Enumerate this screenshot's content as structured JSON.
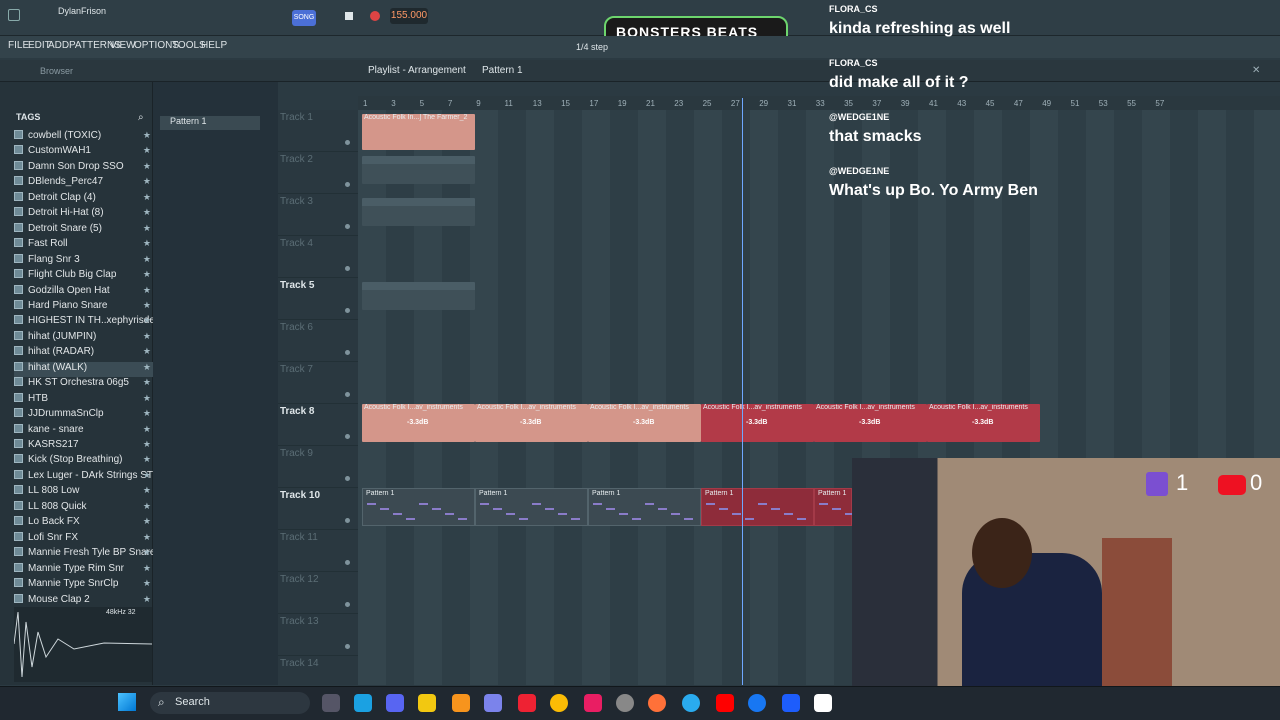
{
  "app": {
    "user": "DylanFrison",
    "tempo": "155.000",
    "snap": "1/4 step",
    "logo_text": "BONSTERS BEATS"
  },
  "menu": [
    "FILE",
    "EDIT",
    "ADD",
    "PATTERNS",
    "VIEW",
    "OPTIONS",
    "TOOLS",
    "HELP"
  ],
  "browser": {
    "title": "Browser",
    "tags_label": "TAGS",
    "items": [
      "cowbell (TOXIC)",
      "CustomWAH1",
      "Damn Son Drop SSO",
      "DBlends_Perc47",
      "Detroit Clap (4)",
      "Detroit Hi-Hat (8)",
      "Detroit Snare (5)",
      "Fast Roll",
      "Flang Snr 3",
      "Flight Club Big Clap",
      "Godzilla Open Hat",
      "Hard Piano Snare",
      "HIGHEST IN TH..xephyrisdead)",
      "hihat (JUMPIN)",
      "hihat (RADAR)",
      "hihat (WALK)",
      "HK ST Orchestra 06g5",
      "HTB",
      "JJDrummaSnClp",
      "kane - snare",
      "KASRS217",
      "Kick (Stop Breathing)",
      "Lex Luger - DArk Strings STC",
      "LL 808 Low",
      "LL 808 Quick",
      "Lo Back FX",
      "Lofi Snr FX",
      "Mannie Fresh Tyle BP Snare",
      "Mannie Type Rim Snr",
      "Mannie Type SnrClp",
      "Mouse Clap 2"
    ],
    "sample_rate": "48kHz 32"
  },
  "playlist": {
    "title": "Playlist - Arrangement",
    "pattern": "Pattern 1",
    "ruler": [
      "1",
      "3",
      "5",
      "7",
      "9",
      "11",
      "13",
      "15",
      "17",
      "19",
      "21",
      "23",
      "25",
      "27",
      "29",
      "31",
      "33",
      "35",
      "37",
      "39",
      "41",
      "43",
      "45",
      "47",
      "49",
      "51",
      "53",
      "55",
      "57"
    ],
    "tracks": [
      "Track 1",
      "Track 2",
      "Track 3",
      "Track 4",
      "Track 5",
      "Track 6",
      "Track 7",
      "Track 8",
      "Track 9",
      "Track 10",
      "Track 11",
      "Track 12",
      "Track 13",
      "Track 14"
    ],
    "clips": {
      "t1": "Acoustic Folk In...] The Farmer_2",
      "t2": "Acoustic Folk I...er_2.wav_drums",
      "t3": "Acoustic Folk In...er_2.wav_bass",
      "t5": "Acoustic Folk In...r_2.wav_vocals",
      "t8": "Acoustic Folk I...av_instruments",
      "db": "-3.3dB",
      "t10": "Pattern 1"
    }
  },
  "chat": [
    {
      "user": "FLORA_CS",
      "msg": "kinda refreshing as well"
    },
    {
      "user": "FLORA_CS",
      "msg": "did make all of it ?"
    },
    {
      "user": "@WEDGE1NE",
      "msg": "that smacks"
    },
    {
      "user": "@WEDGE1NE",
      "msg": "What's up Bo. Yo Army Ben"
    }
  ],
  "viewers": {
    "twitch": "1",
    "youtube": "0"
  },
  "taskbar": {
    "search": "Search"
  },
  "colors": {
    "accent_red": "#b23a48",
    "salmon": "#d4968a",
    "playhead": "#6fa7ff"
  }
}
